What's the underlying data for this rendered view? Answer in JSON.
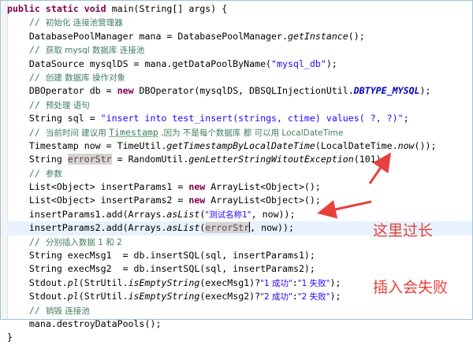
{
  "editor": {
    "lines": [
      {
        "tokens": [
          [
            "kw",
            "public static void "
          ],
          [
            "t",
            "main(String[] args) {"
          ]
        ]
      },
      {
        "tokens": [
          [
            "t",
            "    "
          ],
          [
            "cmt",
            "// "
          ],
          [
            "cn-cmt",
            "初始化 连接池管理器"
          ]
        ]
      },
      {
        "tokens": [
          [
            "t",
            "    DatabasePoolManager mana = DatabasePoolManager."
          ],
          [
            "ital",
            "getInstance"
          ],
          [
            "t",
            "();"
          ]
        ]
      },
      {
        "tokens": [
          [
            "t",
            "    "
          ],
          [
            "cmt",
            "// "
          ],
          [
            "cn-cmt",
            "获取 mysql 数据库 连接池"
          ]
        ]
      },
      {
        "tokens": [
          [
            "t",
            "    DataSource mysqlDS = mana.getDataPoolByName("
          ],
          [
            "str",
            "\"mysql_db\""
          ],
          [
            "t",
            ");"
          ]
        ]
      },
      {
        "tokens": [
          [
            "t",
            "    "
          ],
          [
            "cmt",
            "// "
          ],
          [
            "cn-cmt",
            "创建 数据库 操作对象"
          ]
        ]
      },
      {
        "tokens": [
          [
            "t",
            "    DBOperator db = "
          ],
          [
            "kw",
            "new "
          ],
          [
            "t",
            "DBOperator(mysqlDS, DBSQLInjectionUtil."
          ],
          [
            "field-ital",
            "DBTYPE_MYSQL"
          ],
          [
            "t",
            ");"
          ]
        ]
      },
      {
        "tokens": [
          [
            "t",
            "    "
          ],
          [
            "cmt",
            "// "
          ],
          [
            "cn-cmt",
            "预处理 语句"
          ]
        ]
      },
      {
        "tokens": [
          [
            "t",
            "    String sql = "
          ],
          [
            "str",
            "\"insert into test_insert(strings, ctime) values( ?, ?)\""
          ],
          [
            "t",
            ";"
          ]
        ]
      },
      {
        "tokens": [
          [
            "t",
            "    "
          ],
          [
            "cmt",
            "// "
          ],
          [
            "cn-cmt",
            "当前时间 建议用 "
          ],
          [
            "ts",
            "Timestamp"
          ],
          [
            "cn-cmt",
            " ,因为 不是每个数据库 都 可以用 LocalDateTime"
          ]
        ]
      },
      {
        "tokens": [
          [
            "t",
            "    Timestamp now = TimeUtil."
          ],
          [
            "ital",
            "getTimestampByLocalDateTime"
          ],
          [
            "t",
            "(LocalDateTime."
          ],
          [
            "ital",
            "now"
          ],
          [
            "t",
            "());"
          ]
        ]
      },
      {
        "tokens": [
          [
            "t",
            "    String "
          ],
          [
            "hl",
            "errorStr"
          ],
          [
            "t",
            " = RandomUtil."
          ],
          [
            "ital",
            "genLetterStringWitoutException"
          ],
          [
            "t",
            "(101);"
          ]
        ]
      },
      {
        "tokens": [
          [
            "t",
            "    "
          ],
          [
            "cmt",
            "// "
          ],
          [
            "cn-cmt",
            "参数"
          ]
        ]
      },
      {
        "tokens": [
          [
            "t",
            "    List<Object> insertParams1 = "
          ],
          [
            "kw",
            "new "
          ],
          [
            "t",
            "ArrayList<Object>();"
          ]
        ]
      },
      {
        "tokens": [
          [
            "t",
            "    List<Object> insertParams2 = "
          ],
          [
            "kw",
            "new "
          ],
          [
            "t",
            "ArrayList<Object>();"
          ]
        ]
      },
      {
        "tokens": [
          [
            "t",
            "    insertParams1.add(Arrays."
          ],
          [
            "ital",
            "asList"
          ],
          [
            "t",
            "("
          ],
          [
            "cn-str",
            "\"测试名称1\""
          ],
          [
            "t",
            ", now));"
          ]
        ]
      },
      {
        "current": true,
        "tokens": [
          [
            "t",
            "    insertParams2.add(Arrays."
          ],
          [
            "ital",
            "asList"
          ],
          [
            "t",
            "("
          ],
          [
            "hl",
            "errorStr"
          ],
          [
            "caret",
            ""
          ],
          [
            "t",
            ", now));"
          ]
        ]
      },
      {
        "tokens": [
          [
            "t",
            "    "
          ],
          [
            "cmt",
            "// "
          ],
          [
            "cn-cmt",
            "分别插入数据 1 和 2"
          ]
        ]
      },
      {
        "tokens": [
          [
            "t",
            "    String execMsg1  = db.insertSQL(sql, insertParams1);"
          ]
        ]
      },
      {
        "tokens": [
          [
            "t",
            "    String execMsg2  = db.insertSQL(sql, insertParams2);"
          ]
        ]
      },
      {
        "tokens": [
          [
            "t",
            "    Stdout."
          ],
          [
            "ital",
            "pl"
          ],
          [
            "t",
            "(StrUtil."
          ],
          [
            "ital",
            "isEmptyString"
          ],
          [
            "t",
            "(execMsg1)?"
          ],
          [
            "cn-str",
            "\"1 成功\""
          ],
          [
            "t",
            ":"
          ],
          [
            "cn-str",
            "\"1 失败\""
          ],
          [
            "t",
            ");"
          ]
        ]
      },
      {
        "tokens": [
          [
            "t",
            "    Stdout."
          ],
          [
            "ital",
            "pl"
          ],
          [
            "t",
            "(StrUtil."
          ],
          [
            "ital",
            "isEmptyString"
          ],
          [
            "t",
            "(execMsg2)?"
          ],
          [
            "cn-str",
            "\"2 成功\""
          ],
          [
            "t",
            ":"
          ],
          [
            "cn-str",
            "\"2 失败\""
          ],
          [
            "t",
            ");"
          ]
        ]
      },
      {
        "tokens": [
          [
            "t",
            "    "
          ],
          [
            "cmt",
            "// "
          ],
          [
            "cn-cmt",
            "销毁 连接池"
          ]
        ]
      },
      {
        "tokens": [
          [
            "t",
            "    mana.destroyDataPools();"
          ]
        ]
      },
      {
        "tokens": [
          [
            "t",
            "}"
          ]
        ]
      }
    ]
  },
  "annotation": {
    "line1": "这里过长",
    "line2": "插入会失败",
    "color": "#e8413d"
  }
}
